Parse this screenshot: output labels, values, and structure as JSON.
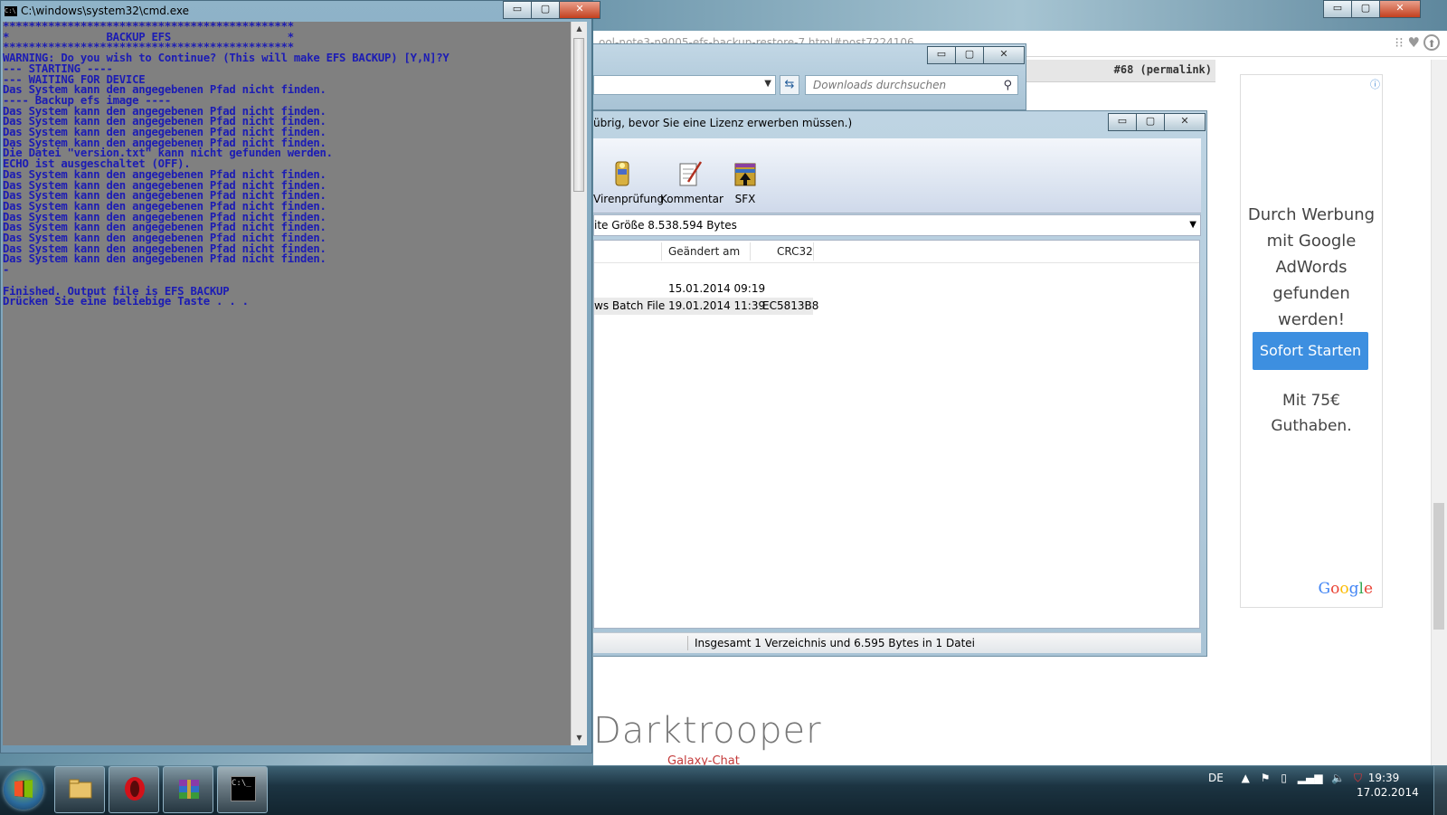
{
  "cmd": {
    "title": "C:\\windows\\system32\\cmd.exe",
    "icon_text": "C:\\",
    "lines": [
      "*********************************************",
      "*               BACKUP EFS                  *",
      "*********************************************",
      "WARNING: Do you wish to Continue? (This will make EFS BACKUP) [Y,N]?Y",
      "--- STARTING ----",
      "--- WAITING FOR DEVICE",
      "Das System kann den angegebenen Pfad nicht finden.",
      "---- Backup efs image ----",
      "Das System kann den angegebenen Pfad nicht finden.",
      "Das System kann den angegebenen Pfad nicht finden.",
      "Das System kann den angegebenen Pfad nicht finden.",
      "Das System kann den angegebenen Pfad nicht finden.",
      "Die Datei \"version.txt\" kann nicht gefunden werden.",
      "ECHO ist ausgeschaltet (OFF).",
      "Das System kann den angegebenen Pfad nicht finden.",
      "Das System kann den angegebenen Pfad nicht finden.",
      "Das System kann den angegebenen Pfad nicht finden.",
      "Das System kann den angegebenen Pfad nicht finden.",
      "Das System kann den angegebenen Pfad nicht finden.",
      "Das System kann den angegebenen Pfad nicht finden.",
      "Das System kann den angegebenen Pfad nicht finden.",
      "Das System kann den angegebenen Pfad nicht finden.",
      "Das System kann den angegebenen Pfad nicht finden.",
      "-",
      "",
      "Finished. Output file is EFS BACKUP",
      "Drücken Sie eine beliebige Taste . . ."
    ]
  },
  "browser": {
    "url": "ool-note3-n9005-efs-backup-restore-7.html#post7224106",
    "permalink": "#68 (permalink)",
    "watermark": "Darktrooper",
    "watermark_sub": "Galaxy-Chat"
  },
  "ad": {
    "info": "ⓘ",
    "headline": "Durch Werbung mit Google AdWords gefunden werden!",
    "button": "Sofort Starten",
    "sub": "Mit 75€ Guthaben.",
    "brand": "Google"
  },
  "explorer": {
    "search_placeholder": "Downloads durchsuchen"
  },
  "winrar": {
    "title": "übrig, bevor Sie eine Lizenz erwerben müssen.)",
    "tools": [
      "Virenprüfung",
      "Kommentar",
      "SFX"
    ],
    "path": "ite Größe 8.538.594 Bytes",
    "columns": [
      "Geändert am",
      "CRC32"
    ],
    "rows": [
      {
        "type": "",
        "date": "15.01.2014 09:19",
        "crc": ""
      },
      {
        "type": "ws Batch File",
        "date": "19.01.2014 11:39",
        "crc": "EC5813B8"
      }
    ],
    "status": "Insgesamt 1 Verzeichnis und 6.595 Bytes in 1 Datei"
  },
  "window_controls": {
    "min": "▭",
    "max": "▢",
    "close": "✕"
  },
  "taskbar": {
    "lang": "DE",
    "time": "19:39",
    "date": "17.02.2014",
    "cmd_icon": "C:\\_"
  }
}
